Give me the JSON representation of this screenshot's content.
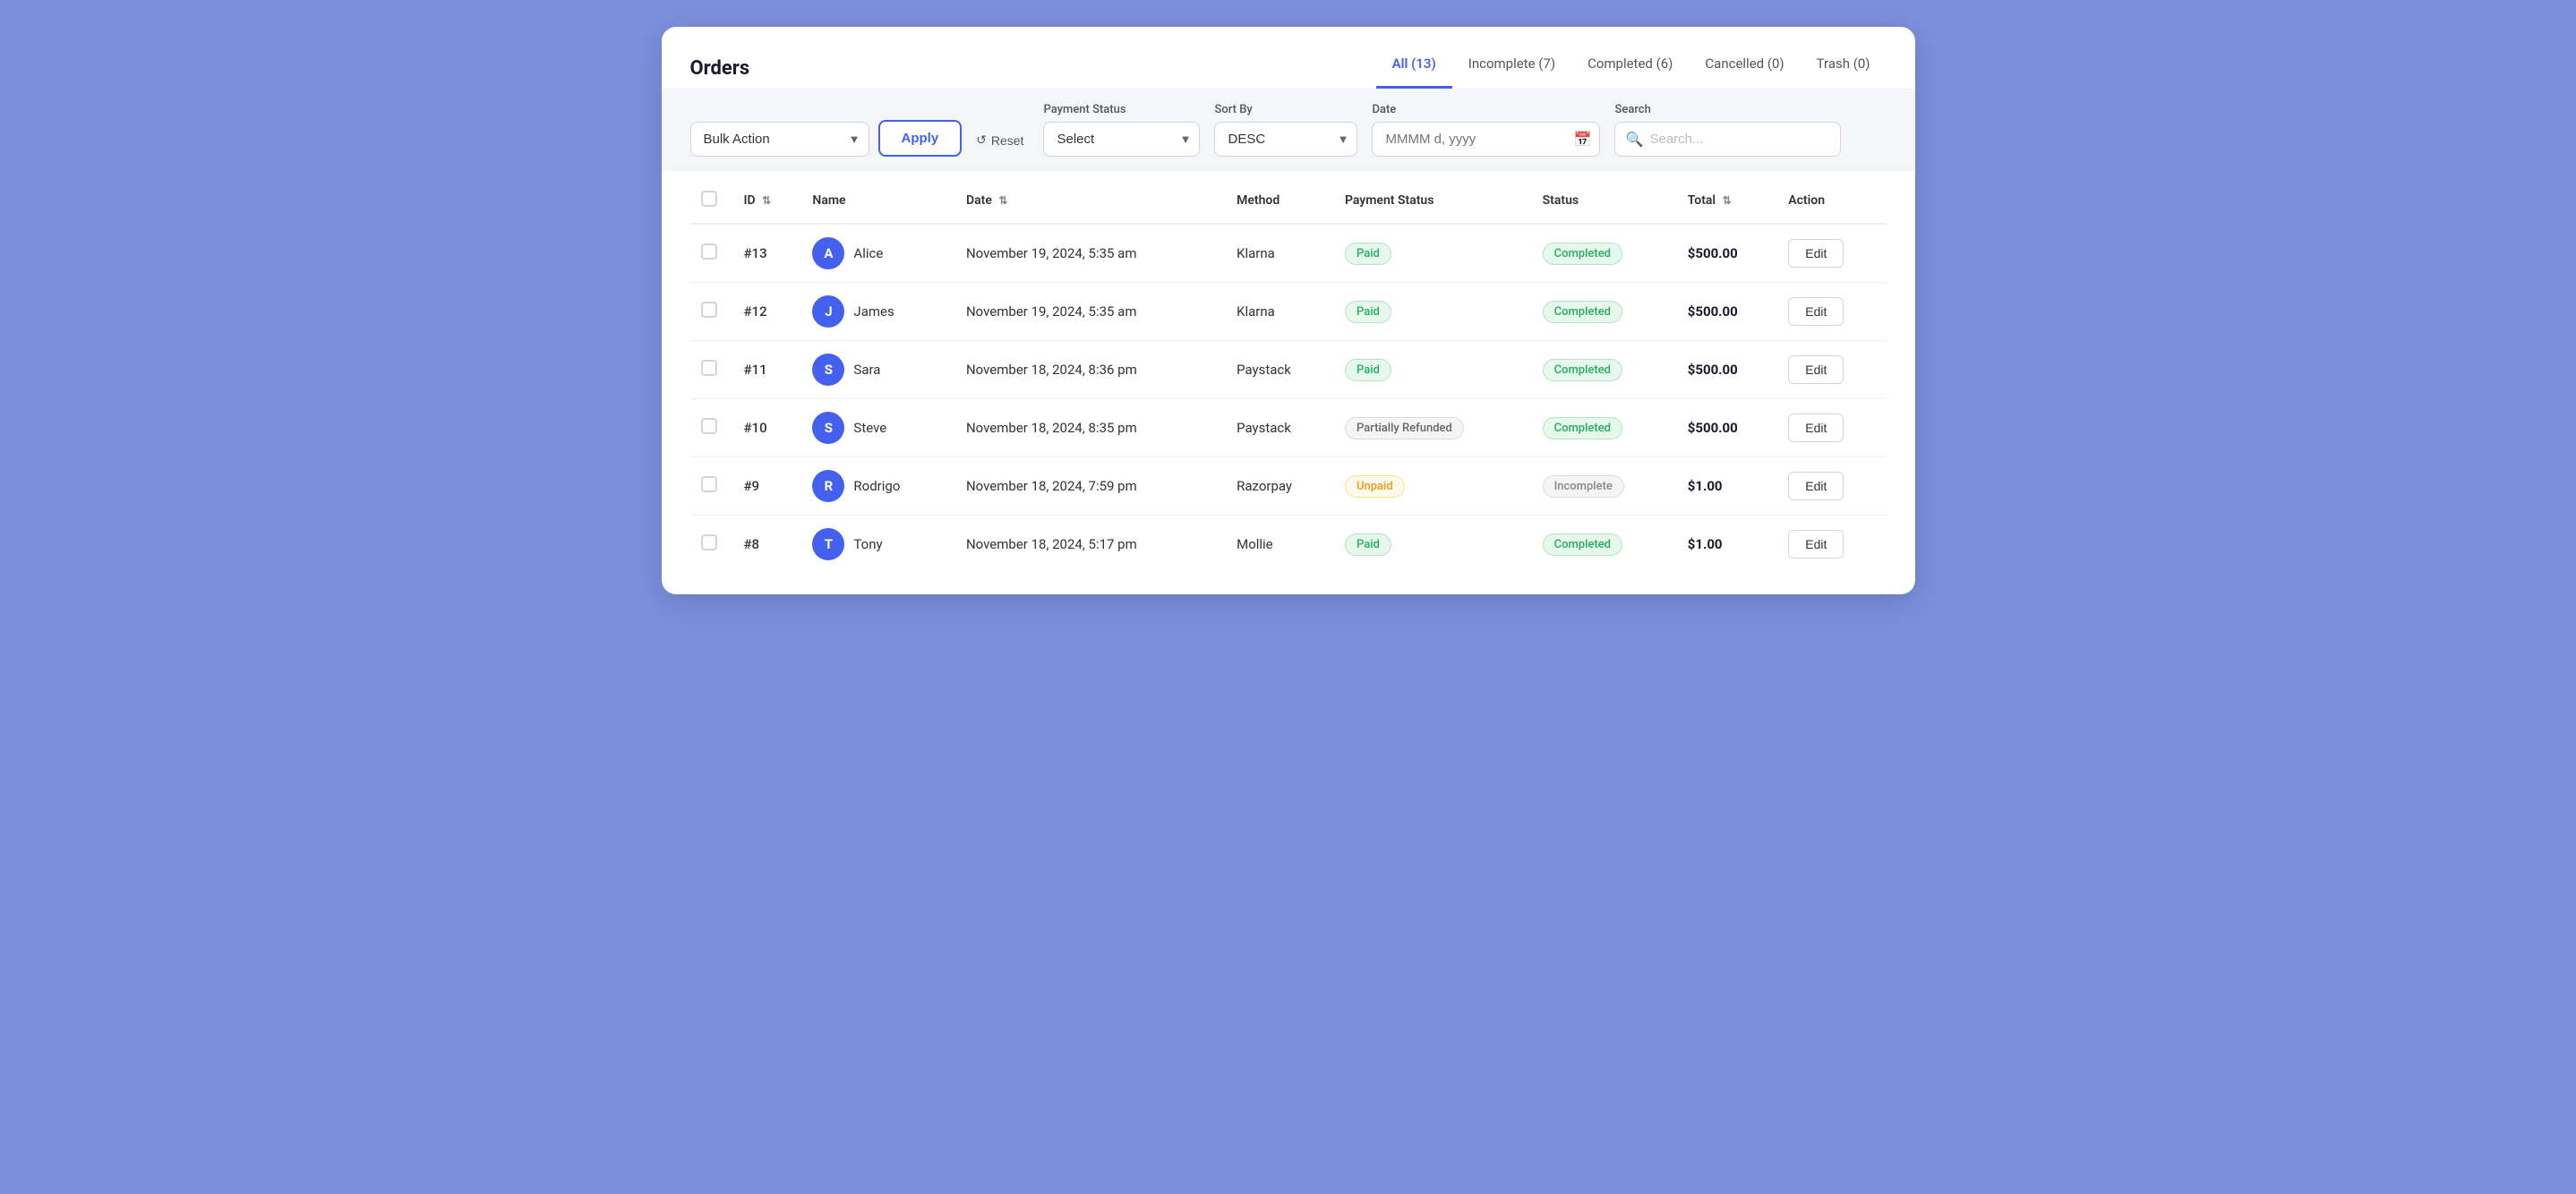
{
  "header": {
    "title": "Orders",
    "tabs": [
      {
        "id": "all",
        "label": "All (13)",
        "active": true
      },
      {
        "id": "incomplete",
        "label": "Incomplete (7)",
        "active": false
      },
      {
        "id": "completed",
        "label": "Completed (6)",
        "active": false
      },
      {
        "id": "cancelled",
        "label": "Cancelled (0)",
        "active": false
      },
      {
        "id": "trash",
        "label": "Trash (0)",
        "active": false
      }
    ]
  },
  "filters": {
    "bulk_action_label": "Bulk Action",
    "apply_label": "Apply",
    "reset_label": "Reset",
    "payment_status_label": "Payment Status",
    "payment_status_placeholder": "Select",
    "sort_by_label": "Sort By",
    "sort_by_value": "DESC",
    "date_label": "Date",
    "date_placeholder": "MMMM d, yyyy",
    "search_label": "Search",
    "search_placeholder": "Search..."
  },
  "table": {
    "columns": [
      {
        "id": "check",
        "label": ""
      },
      {
        "id": "id",
        "label": "ID",
        "sortable": true
      },
      {
        "id": "name",
        "label": "Name",
        "sortable": false
      },
      {
        "id": "date",
        "label": "Date",
        "sortable": true
      },
      {
        "id": "method",
        "label": "Method",
        "sortable": false
      },
      {
        "id": "payment_status",
        "label": "Payment Status",
        "sortable": false
      },
      {
        "id": "status",
        "label": "Status",
        "sortable": false
      },
      {
        "id": "total",
        "label": "Total",
        "sortable": true
      },
      {
        "id": "action",
        "label": "Action",
        "sortable": false
      }
    ],
    "rows": [
      {
        "id": "#13",
        "avatar_letter": "A",
        "name": "Alice",
        "date": "November 19, 2024, 5:35 am",
        "method": "Klarna",
        "payment_status": "Paid",
        "payment_status_type": "paid",
        "status": "Completed",
        "status_type": "completed",
        "total": "$500.00",
        "action": "Edit"
      },
      {
        "id": "#12",
        "avatar_letter": "J",
        "name": "James",
        "date": "November 19, 2024, 5:35 am",
        "method": "Klarna",
        "payment_status": "Paid",
        "payment_status_type": "paid",
        "status": "Completed",
        "status_type": "completed",
        "total": "$500.00",
        "action": "Edit"
      },
      {
        "id": "#11",
        "avatar_letter": "S",
        "name": "Sara",
        "date": "November 18, 2024, 8:36 pm",
        "method": "Paystack",
        "payment_status": "Paid",
        "payment_status_type": "paid",
        "status": "Completed",
        "status_type": "completed",
        "total": "$500.00",
        "action": "Edit"
      },
      {
        "id": "#10",
        "avatar_letter": "S",
        "name": "Steve",
        "date": "November 18, 2024, 8:35 pm",
        "method": "Paystack",
        "payment_status": "Partially Refunded",
        "payment_status_type": "partial",
        "status": "Completed",
        "status_type": "completed",
        "total": "$500.00",
        "action": "Edit"
      },
      {
        "id": "#9",
        "avatar_letter": "R",
        "name": "Rodrigo",
        "date": "November 18, 2024, 7:59 pm",
        "method": "Razorpay",
        "payment_status": "Unpaid",
        "payment_status_type": "unpaid",
        "status": "Incomplete",
        "status_type": "incomplete",
        "total": "$1.00",
        "action": "Edit"
      },
      {
        "id": "#8",
        "avatar_letter": "T",
        "name": "Tony",
        "date": "November 18, 2024, 5:17 pm",
        "method": "Mollie",
        "payment_status": "Paid",
        "payment_status_type": "paid",
        "status": "Completed",
        "status_type": "completed",
        "total": "$1.00",
        "action": "Edit"
      }
    ]
  },
  "colors": {
    "accent": "#4361ee",
    "paid_bg": "#e6f7ec",
    "paid_text": "#27ae60",
    "unpaid_bg": "#fff8ec",
    "unpaid_text": "#f39c12"
  }
}
